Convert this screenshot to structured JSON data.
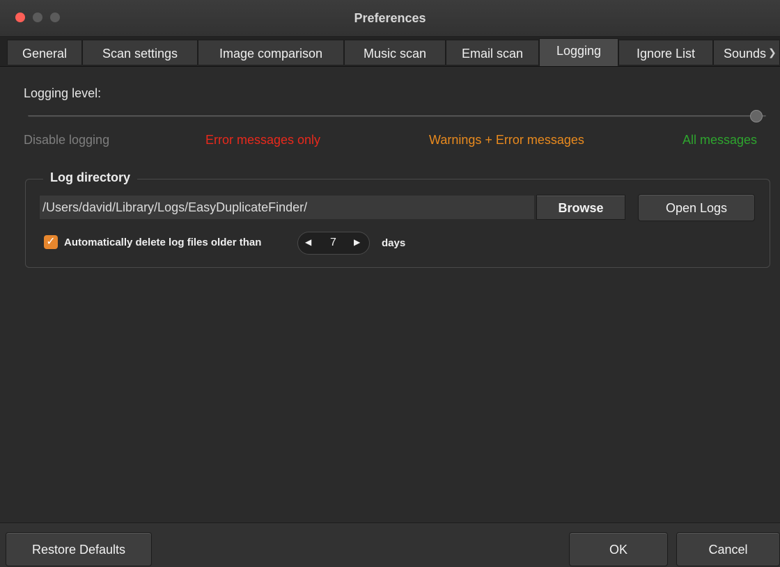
{
  "window": {
    "title": "Preferences"
  },
  "tabs": [
    {
      "label": "General"
    },
    {
      "label": "Scan settings"
    },
    {
      "label": "Image comparison"
    },
    {
      "label": "Music scan"
    },
    {
      "label": "Email scan"
    },
    {
      "label": "Logging",
      "active": true
    },
    {
      "label": "Ignore List"
    },
    {
      "label": "Sounds"
    }
  ],
  "logging": {
    "label": "Logging level:",
    "level_index": 3,
    "levels": [
      {
        "label": "Disable logging",
        "color": "#7e7e7e"
      },
      {
        "label": "Error messages only",
        "color": "#e8291c"
      },
      {
        "label": "Warnings + Error messages",
        "color": "#e98a1e"
      },
      {
        "label": "All messages",
        "color": "#2ea52e"
      }
    ]
  },
  "log_directory": {
    "title": "Log directory",
    "path": "/Users/david/Library/Logs/EasyDuplicateFinder/",
    "browse_label": "Browse",
    "open_logs_label": "Open Logs",
    "auto_delete": {
      "checked": true,
      "label": "Automatically delete log files older than",
      "days_value": "7",
      "unit_label": "days"
    }
  },
  "footer": {
    "restore_label": "Restore Defaults",
    "ok_label": "OK",
    "cancel_label": "Cancel"
  },
  "colors": {
    "accent": "#e7872e",
    "close": "#fe5f57"
  }
}
